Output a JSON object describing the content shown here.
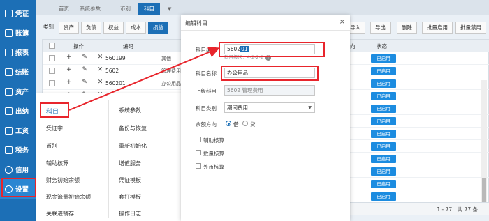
{
  "sidebar": {
    "items": [
      {
        "label": "凭证",
        "icon": "voucher-icon"
      },
      {
        "label": "账簿",
        "icon": "ledger-icon"
      },
      {
        "label": "报表",
        "icon": "report-icon"
      },
      {
        "label": "结账",
        "icon": "closing-icon"
      },
      {
        "label": "资产",
        "icon": "asset-icon"
      },
      {
        "label": "出纳",
        "icon": "cashier-icon"
      },
      {
        "label": "工资",
        "icon": "salary-icon"
      },
      {
        "label": "税务",
        "icon": "tax-icon"
      },
      {
        "label": "信用",
        "icon": "credit-icon"
      },
      {
        "label": "设置",
        "icon": "gear-icon"
      }
    ]
  },
  "tabs": [
    "首页",
    "系统参数",
    "币别",
    "科目"
  ],
  "toolbar": {
    "left": [
      "类别",
      "资产",
      "负债",
      "权益",
      "成本",
      "损益"
    ],
    "right": [
      "导入",
      "导出",
      "删除",
      "批量启用",
      "批量禁用"
    ]
  },
  "grid": {
    "headers": {
      "ops": "操作",
      "code": "编码",
      "dir": "向",
      "status": "状态"
    },
    "rows": [
      {
        "code": "560199",
        "name": "其他",
        "status": "已启用"
      },
      {
        "code": "5602",
        "name": "管理费用",
        "status": "已启用"
      },
      {
        "code": "560201",
        "name": "办公用品",
        "status": "已启用"
      },
      {
        "code": "",
        "name": "",
        "status": "已启用"
      },
      {
        "code": "",
        "name": "",
        "status": "已启用"
      },
      {
        "code": "",
        "name": "",
        "status": "已启用"
      },
      {
        "code": "",
        "name": "",
        "status": "已启用"
      },
      {
        "code": "",
        "name": "",
        "status": "已启用"
      },
      {
        "code": "",
        "name": "",
        "status": "已启用"
      },
      {
        "code": "",
        "name": "",
        "status": "已启用"
      },
      {
        "code": "",
        "name": "",
        "status": "已启用"
      },
      {
        "code": "",
        "name": "",
        "status": "已启用"
      },
      {
        "code": "",
        "name": "",
        "status": "已启用"
      }
    ],
    "pager": "1 - 77　共 77 条"
  },
  "menu": {
    "left": [
      "科目",
      "凭证字",
      "币别",
      "辅助核算",
      "财务初始余额",
      "现金流量初始余额",
      "关联进销存"
    ],
    "right": [
      "系统参数",
      "备份与恢复",
      "重新初始化",
      "增值服务",
      "凭证模板",
      "套打模板",
      "操作日志"
    ]
  },
  "dialog": {
    "title": "编辑科目",
    "close": "×",
    "code_label": "科目编码",
    "code_prefix": "5602",
    "code_selected": "01",
    "code_hint": "科目级次：4-2-2-2",
    "name_label": "科目名称",
    "name_value": "办公用品",
    "parent_label": "上级科目",
    "parent_value": "5602 管理费用",
    "category_label": "科目类别",
    "category_value": "期间费用",
    "balance_label": "余额方向",
    "balance_debit": "借",
    "balance_credit": "贷",
    "checks": [
      "辅助核算",
      "数量核算",
      "外币核算"
    ]
  },
  "colors": {
    "primary": "#1c6fb6",
    "highlight": "#e8252c",
    "badge": "#1c8ce0"
  }
}
